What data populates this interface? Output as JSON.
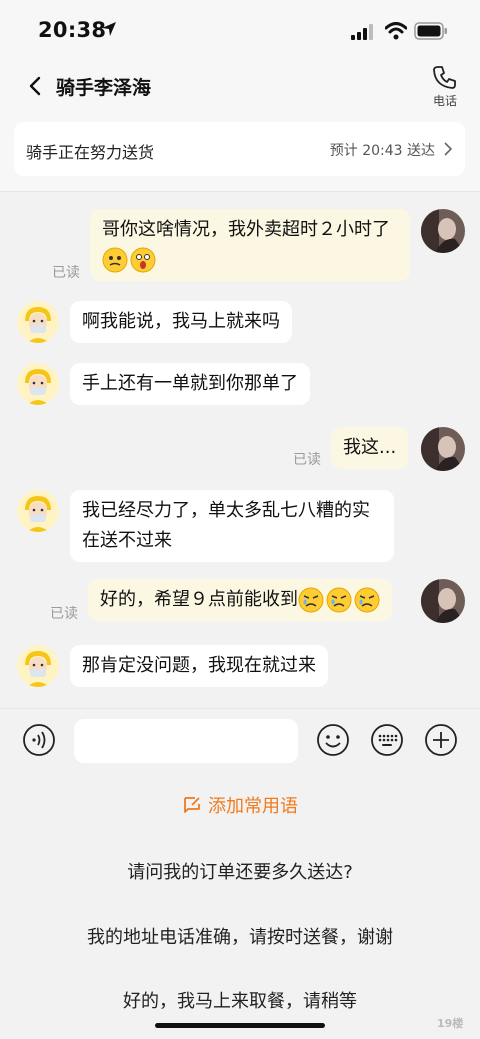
{
  "status_bar": {
    "time": "20:38"
  },
  "nav": {
    "title": "骑手李泽海",
    "call_label": "电话"
  },
  "delivery": {
    "status_text": "骑手正在努力送货",
    "eta_text": "预计 20:43 送达"
  },
  "messages": {
    "m1_text": "哥你这啥情况，我外卖超时２小时了",
    "m1_read": "已读",
    "m2_text": "啊我能说，我马上就来吗",
    "m3_text": "手上还有一单就到你那单了",
    "m4_text": "我这...",
    "m4_read": "已读",
    "m5_text": "我已经尽力了，单太多乱七八糟的实在送不过来",
    "m6_text": "好的，希望９点前能收到",
    "m6_read": "已读",
    "m7_text": "那肯定没问题，我现在就过来"
  },
  "quick": {
    "add_label": "添加常用语",
    "phrases": [
      "请问我的订单还要多久送达?",
      "我的地址电话准确，请按时送餐，谢谢",
      "好的，我马上来取餐，请稍等"
    ]
  },
  "input": {
    "value": ""
  },
  "watermark": "19楼",
  "colors": {
    "accent": "#f07a1c",
    "my_bubble": "#fbf7e3",
    "other_bubble": "#ffffff"
  }
}
